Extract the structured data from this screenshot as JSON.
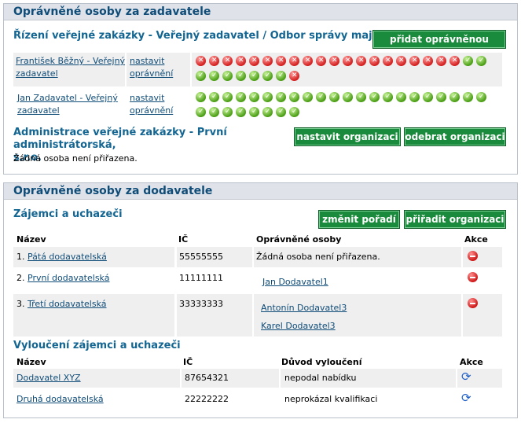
{
  "zadavatel": {
    "heading": "Oprávněné osoby za zadavatele",
    "section_title": "Řízení veřejné zakázky - Veřejný zadavatel / Odbor správy majetku",
    "add_button": "přidat oprávněnou osobu",
    "persons": [
      {
        "name_line1": "František Běžný - Veřejný",
        "name_line2": "zadavatel",
        "action_line1": "nastavit",
        "action_line2": "oprávnění",
        "rights": [
          "x",
          "x",
          "x",
          "x",
          "x",
          "x",
          "x",
          "x",
          "x",
          "x",
          "x",
          "x",
          "x",
          "x",
          "x",
          "x",
          "x",
          "x",
          "x",
          "x",
          "c",
          "c",
          "c",
          "c",
          "c",
          "c",
          "c",
          "c",
          "c",
          "x"
        ]
      },
      {
        "name_line1": "Jan Zadavatel - Veřejný",
        "name_line2": "zadavatel",
        "action_line1": "nastavit",
        "action_line2": "oprávnění",
        "rights": [
          "c",
          "c",
          "c",
          "c",
          "c",
          "c",
          "c",
          "c",
          "c",
          "c",
          "c",
          "c",
          "c",
          "c",
          "c",
          "c",
          "c",
          "c",
          "c",
          "c",
          "c",
          "c",
          "c",
          "c",
          "c",
          "c",
          "c",
          "c",
          "c",
          "c"
        ]
      }
    ],
    "admin_title_line1": "Administrace veřejné zakázky - První administrátorská,",
    "admin_title_line2": "s.r.o.",
    "admin_empty": "Žádná osoba není přiřazena.",
    "set_org_button": "nastavit organizaci",
    "remove_org_button": "odebrat organizaci"
  },
  "dodavatel": {
    "heading": "Oprávněné osoby za dodavatele",
    "section_title": "Zájemci a uchazeči",
    "change_order_button": "změnit pořadí",
    "assign_org_button": "přiřadit organizaci",
    "columns": {
      "name": "Název",
      "ic": "IČ",
      "persons": "Oprávněné osoby",
      "action": "Akce"
    },
    "rows": [
      {
        "num": "1.",
        "name": "Pátá dodavatelská",
        "ic": "55555555",
        "persons_text": "Žádná osoba není přiřazena.",
        "persons": []
      },
      {
        "num": "2.",
        "name": "První dodavatelská",
        "ic": "11111111",
        "persons_text": "",
        "persons": [
          "Jan Dodavatel1"
        ]
      },
      {
        "num": "3.",
        "name": "Třetí dodavatelská",
        "ic": "33333333",
        "persons_text": "",
        "persons": [
          "Antonín Dodavatel3",
          "Karel Dodavatel3"
        ]
      }
    ],
    "excluded_title": "Vyloučení zájemci a uchazeči",
    "excluded_columns": {
      "name": "Název",
      "ic": "IČ",
      "reason": "Důvod vyloučení",
      "action": "Akce"
    },
    "excluded_rows": [
      {
        "name": "Dodavatel XYZ",
        "ic": "87654321",
        "reason": "nepodal nabídku"
      },
      {
        "name": "Druhá dodavatelská",
        "ic": "22222222",
        "reason": "neprokázal kvalifikaci"
      }
    ]
  }
}
